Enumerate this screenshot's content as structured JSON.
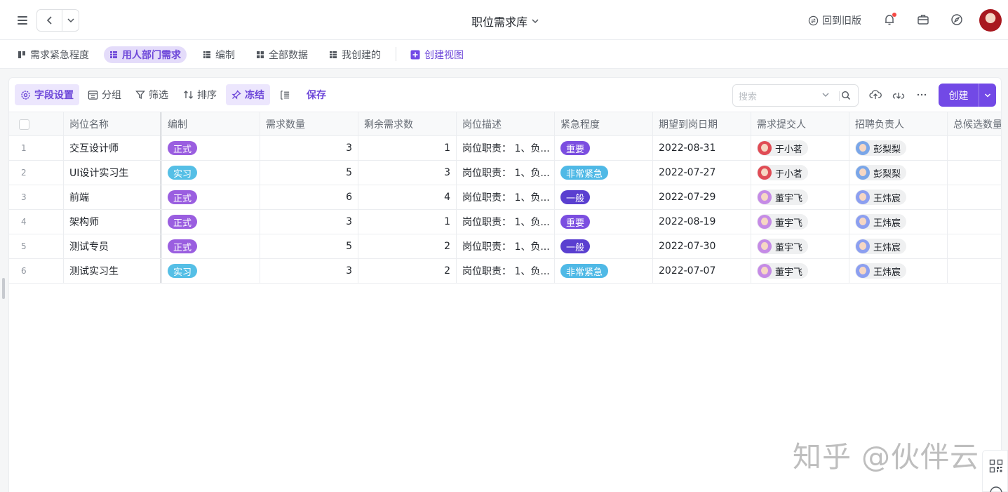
{
  "topbar": {
    "title": "职位需求库",
    "old_version_label": "回到旧版"
  },
  "views": [
    {
      "label": "需求紧急程度",
      "icon": "kanban-icon",
      "active": false
    },
    {
      "label": "用人部门需求",
      "icon": "grid-table-icon",
      "active": true
    },
    {
      "label": "编制",
      "icon": "grid-table-icon",
      "active": false
    },
    {
      "label": "全部数据",
      "icon": "gallery-icon",
      "active": false
    },
    {
      "label": "我创建的",
      "icon": "grid-table-icon",
      "active": false
    }
  ],
  "create_view_label": "创建视图",
  "toolbar": {
    "field_settings": "字段设置",
    "group": "分组",
    "filter": "筛选",
    "sort": "排序",
    "freeze": "冻结",
    "save": "保存",
    "search_placeholder": "搜索",
    "create": "创建"
  },
  "colors": {
    "accent": "#7249e6",
    "tag_formal": "#9a5ee0",
    "tag_intern": "#55bfe6",
    "tag_important": "#7b4ee0",
    "tag_urgent": "#4fb9e6",
    "tag_normal": "#5a3fd0"
  },
  "table": {
    "headers": [
      "岗位名称",
      "编制",
      "需求数量",
      "剩余需求数",
      "岗位描述",
      "紧急程度",
      "期望到岗日期",
      "需求提交人",
      "招聘负责人",
      "总候选数量"
    ],
    "rows": [
      {
        "index": "1",
        "name": "交互设计师",
        "staffing": "正式",
        "demand": "3",
        "remaining": "1",
        "desc": "岗位职责： 1、负...",
        "urgency": "重要",
        "date": "2022-08-31",
        "submitter": "于小茗",
        "recruiter": "彭梨梨"
      },
      {
        "index": "2",
        "name": "UI设计实习生",
        "staffing": "实习",
        "demand": "5",
        "remaining": "3",
        "desc": "岗位职责： 1、负...",
        "urgency": "非常紧急",
        "date": "2022-07-27",
        "submitter": "于小茗",
        "recruiter": "彭梨梨"
      },
      {
        "index": "3",
        "name": "前端",
        "staffing": "正式",
        "demand": "6",
        "remaining": "4",
        "desc": "岗位职责： 1、负...",
        "urgency": "一般",
        "date": "2022-07-29",
        "submitter": "董宇飞",
        "recruiter": "王炜宸"
      },
      {
        "index": "4",
        "name": "架构师",
        "staffing": "正式",
        "demand": "3",
        "remaining": "1",
        "desc": "岗位职责： 1、负...",
        "urgency": "重要",
        "date": "2022-08-19",
        "submitter": "董宇飞",
        "recruiter": "王炜宸"
      },
      {
        "index": "5",
        "name": "测试专员",
        "staffing": "正式",
        "demand": "5",
        "remaining": "2",
        "desc": "岗位职责： 1、负...",
        "urgency": "一般",
        "date": "2022-07-30",
        "submitter": "董宇飞",
        "recruiter": "王炜宸"
      },
      {
        "index": "6",
        "name": "测试实习生",
        "staffing": "实习",
        "demand": "3",
        "remaining": "2",
        "desc": "岗位职责： 1、负...",
        "urgency": "非常紧急",
        "date": "2022-07-07",
        "submitter": "董宇飞",
        "recruiter": "王炜宸"
      }
    ]
  },
  "watermark": "知乎 @伙伴云"
}
